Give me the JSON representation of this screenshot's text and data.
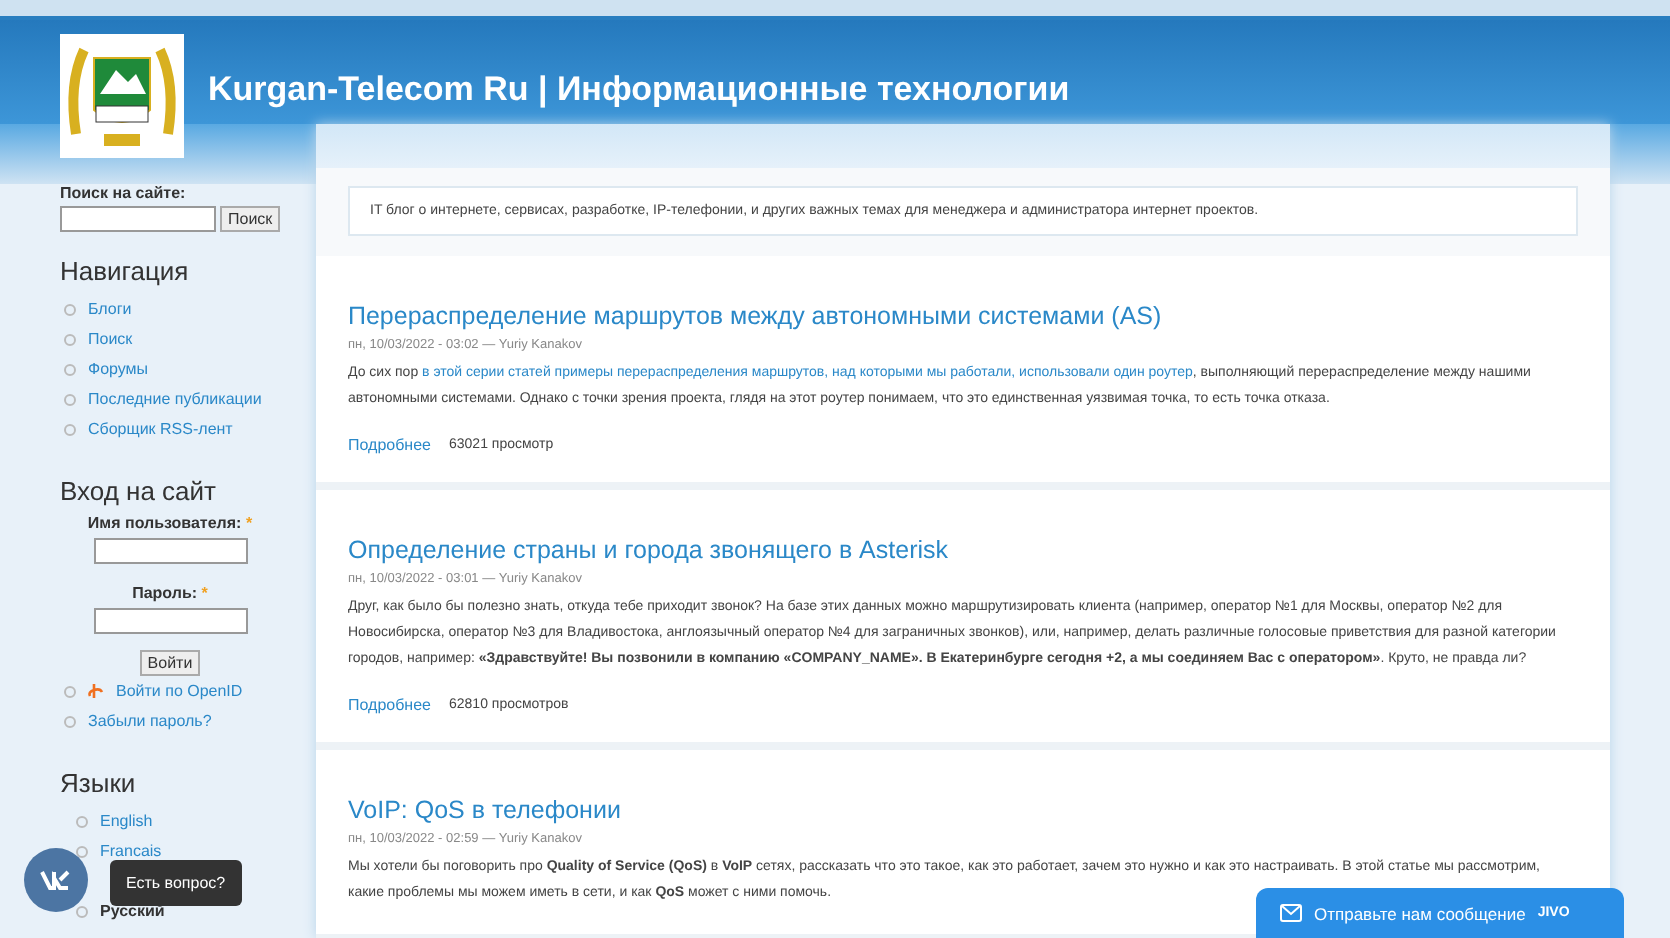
{
  "header": {
    "site_title": "Kurgan-Telecom Ru | Информационные технологии"
  },
  "sidebar": {
    "search": {
      "label": "Поиск на сайте:",
      "button": "Поиск"
    },
    "navigation": {
      "title": "Навигация",
      "items": [
        {
          "label": "Блоги"
        },
        {
          "label": "Поиск"
        },
        {
          "label": "Форумы"
        },
        {
          "label": "Последние публикации"
        },
        {
          "label": "Сборщик RSS-лент"
        }
      ]
    },
    "login": {
      "title": "Вход на сайт",
      "username_label": "Имя пользователя:",
      "password_label": "Пароль:",
      "required_mark": "*",
      "button": "Войти",
      "links": [
        {
          "label": "Войти по OpenID",
          "kind": "openid"
        },
        {
          "label": "Забыли пароль?",
          "kind": "plain"
        }
      ]
    },
    "languages": {
      "title": "Языки",
      "items": [
        {
          "label": "English",
          "selected": false
        },
        {
          "label": "Francais",
          "selected": false
        },
        {
          "label": "Русский",
          "selected": true
        }
      ]
    }
  },
  "intro": "IT блог о интернете, сервисах, разработке, IP-телефонии, и других важных темах для менеджера и администратора интернет проектов.",
  "posts": [
    {
      "title": "Перераспределение маршрутов между автономными системами (AS)",
      "meta": "пн, 10/03/2022 - 03:02 — Yuriy Kanakov",
      "body": [
        {
          "kind": "text",
          "text": "До сих пор "
        },
        {
          "kind": "link",
          "text": "в этой серии статей примеры перераспределения маршрутов, над которыми мы работали, использовали один роутер"
        },
        {
          "kind": "text",
          "text": ", выполняющий перераспределение между нашими автономными системами. Однако с точки зрения проекта, глядя на этот роутер понимаем, что это единственная уязвимая точка, то есть точка отказа."
        }
      ],
      "more": "Подробнее",
      "views": "63021 просмотр"
    },
    {
      "title": "Определение страны и города звонящего в Asterisk",
      "meta": "пн, 10/03/2022 - 03:01 — Yuriy Kanakov",
      "body": [
        {
          "kind": "text",
          "text": "Друг, как было бы полезно знать, откуда тебе приходит звонок? На базе этих данных можно маршрутизировать клиента (например, оператор №1 для Москвы, оператор №2 для Новосибирска, оператор №3 для Владивостока, англоязычный оператор №4 для заграничных звонков), или, например, делать различные голосовые приветствия для разной категории городов, например: **«Здравствуйте! Вы позвонили в компанию «COMPANY_NAME». В Екатеринбурге сегодня +2, а мы соединяем Вас с оператором»**. Круто, не правда ли?"
        }
      ],
      "more": "Подробнее",
      "views": "62810 просмотров"
    },
    {
      "title": "VoIP: QoS в телефонии",
      "meta": "пн, 10/03/2022 - 02:59 — Yuriy Kanakov",
      "body": [
        {
          "kind": "text",
          "text": "Мы хотели бы поговорить про **Quality of Service (QoS)** в **VoIP** сетях, рассказать что это такое, как это работает, зачем это нужно и как это настраивать. В этой статье мы рассмотрим, какие проблемы мы можем иметь в сети, и как **QoS** может с ними помочь."
        }
      ]
    }
  ],
  "chat": {
    "tooltip": "Есть вопрос?",
    "message_button": "Отправьте нам сообщение",
    "brand": "JIVO"
  }
}
